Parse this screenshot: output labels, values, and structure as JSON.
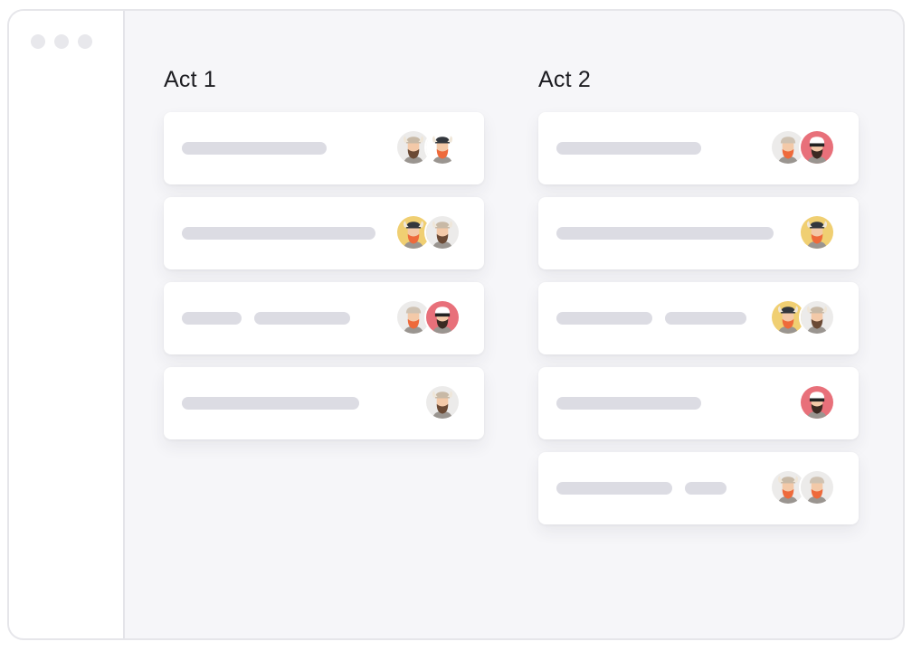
{
  "board": {
    "columns": [
      {
        "title": "Act 1",
        "cards": [
          {
            "bars": [
              160
            ],
            "avatars": [
              "brown-viking",
              "red-beard-dark-helmet"
            ]
          },
          {
            "bars": [
              214
            ],
            "avatars": [
              "yellow-dark-helmet",
              "brown-viking"
            ]
          },
          {
            "bars": [
              66,
              106
            ],
            "avatars": [
              "red-beard-light-helmet",
              "headband-pink"
            ]
          },
          {
            "bars": [
              196
            ],
            "avatars": [
              "brown-viking"
            ]
          }
        ]
      },
      {
        "title": "Act 2",
        "cards": [
          {
            "bars": [
              160
            ],
            "avatars": [
              "red-beard-light-helmet",
              "headband-pink"
            ]
          },
          {
            "bars": [
              240
            ],
            "avatars": [
              "yellow-dark-helmet"
            ]
          },
          {
            "bars": [
              106,
              90
            ],
            "avatars": [
              "yellow-dark-helmet",
              "brown-viking"
            ]
          },
          {
            "bars": [
              160
            ],
            "avatars": [
              "headband-pink"
            ]
          },
          {
            "bars": [
              128,
              46
            ],
            "avatars": [
              "red-beard-viking",
              "red-beard-light-helmet"
            ]
          }
        ]
      }
    ]
  },
  "colors": {
    "bar": "#dcdce3",
    "avatar_light_bg": "#ecebea",
    "avatar_yellow_bg": "#f0cf72",
    "avatar_pink_bg": "#e8707a",
    "beard_red": "#ee6a3b",
    "beard_brown": "#6b4a35"
  }
}
